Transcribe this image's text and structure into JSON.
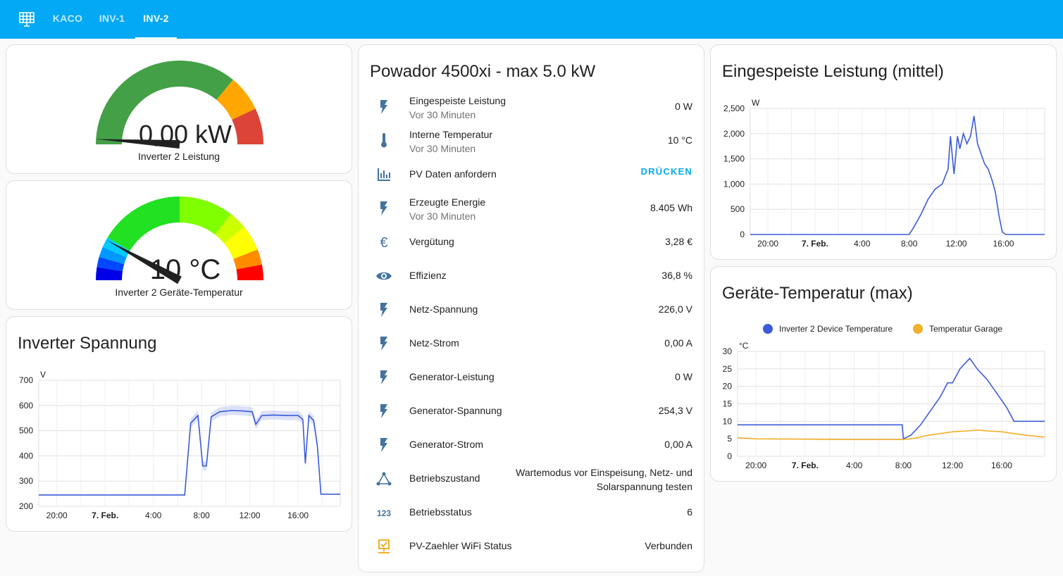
{
  "nav": {
    "tabs": [
      {
        "label": "KACO"
      },
      {
        "label": "INV-1"
      },
      {
        "label": "INV-2",
        "active": true
      }
    ],
    "accent": "#03a9f4",
    "icon": "solar-panel-grid-icon"
  },
  "gauge_power": {
    "value": "0,00 kW",
    "label": "Inverter 2 Leistung",
    "level": 0.0,
    "colors": {
      "green": "#43a047",
      "orange": "#ffa600",
      "red": "#db4437"
    }
  },
  "gauge_temp": {
    "value": "10 °C",
    "label": "Inverter 2 Geräte-Temperatur",
    "level": 0.16
  },
  "entities": {
    "title": "Powador 4500xi - max 5.0 kW",
    "rows": [
      {
        "icon": "flash-icon",
        "name": "Eingespeiste Leistung",
        "sub": "Vor 30 Minuten",
        "value": "0 W"
      },
      {
        "icon": "thermometer-icon",
        "name": "Interne Temperatur",
        "sub": "Vor 30 Minuten",
        "value": "10 °C"
      },
      {
        "icon": "bar-chart-icon",
        "name": "PV Daten anfordern",
        "button": "DRÜCKEN"
      },
      {
        "icon": "flash-icon",
        "name": "Erzeugte Energie",
        "sub": "Vor 30 Minuten",
        "value": "8.405 Wh"
      },
      {
        "icon": "euro-icon",
        "name": "Vergütung",
        "value": "3,28 €"
      },
      {
        "icon": "eye-icon",
        "name": "Effizienz",
        "value": "36,8 %"
      },
      {
        "icon": "flash-icon",
        "name": "Netz-Spannung",
        "value": "226,0 V"
      },
      {
        "icon": "flash-icon",
        "name": "Netz-Strom",
        "value": "0,00 A"
      },
      {
        "icon": "flash-icon",
        "name": "Generator-Leistung",
        "value": "0 W"
      },
      {
        "icon": "flash-icon",
        "name": "Generator-Spannung",
        "value": "254,3 V"
      },
      {
        "icon": "flash-icon",
        "name": "Generator-Strom",
        "value": "0,00 A"
      },
      {
        "icon": "network-icon",
        "name": "Betriebszustand",
        "value": "Wartemodus vor Einspeisung, Netz- und Solarspannung testen"
      },
      {
        "icon": "numeric-icon",
        "icon_text": "123",
        "name": "Betriebsstatus",
        "value": "6"
      },
      {
        "icon": "wifi-status-icon",
        "name": "PV-Zaehler WiFi Status",
        "value": "Verbunden"
      }
    ]
  },
  "chart_data": [
    {
      "type": "line",
      "title": "Inverter Spannung",
      "ylabel": "V",
      "xlabels": [
        "20:00",
        "7. Feb.",
        "4:00",
        "8:00",
        "12:00",
        "16:00"
      ],
      "x_hours": [
        20,
        24,
        28,
        32,
        36,
        40
      ],
      "yticks": [
        200,
        300,
        400,
        500,
        600,
        700
      ],
      "ylim": [
        200,
        700
      ],
      "xlim": [
        18.5,
        43.5
      ],
      "series": [
        {
          "color": "#3b5bdb",
          "points": [
            [
              18.5,
              245
            ],
            [
              30.6,
              245
            ],
            [
              31.1,
              530
            ],
            [
              31.7,
              560
            ],
            [
              32.1,
              360
            ],
            [
              32.4,
              360
            ],
            [
              32.8,
              555
            ],
            [
              33.5,
              575
            ],
            [
              34.5,
              580
            ],
            [
              35.5,
              578
            ],
            [
              36.2,
              575
            ],
            [
              36.5,
              525
            ],
            [
              37.0,
              560
            ],
            [
              38.0,
              562
            ],
            [
              39.0,
              560
            ],
            [
              40.0,
              560
            ],
            [
              40.4,
              545
            ],
            [
              40.6,
              370
            ],
            [
              40.9,
              560
            ],
            [
              41.3,
              540
            ],
            [
              41.6,
              440
            ],
            [
              41.9,
              248
            ],
            [
              43.5,
              248
            ]
          ]
        }
      ]
    },
    {
      "type": "line",
      "title": "Eingespeiste Leistung (mittel)",
      "ylabel": "W",
      "xlabels": [
        "20:00",
        "7. Feb.",
        "4:00",
        "8:00",
        "12:00",
        "16:00"
      ],
      "x_hours": [
        20,
        24,
        28,
        32,
        36,
        40
      ],
      "yticks": [
        0,
        500,
        1000,
        1500,
        2000,
        2500
      ],
      "ylim": [
        0,
        2500
      ],
      "xlim": [
        18.5,
        43.5
      ],
      "series": [
        {
          "color": "#3b5bdb",
          "points": [
            [
              18.5,
              0
            ],
            [
              32.0,
              0
            ],
            [
              32.4,
              150
            ],
            [
              33.0,
              400
            ],
            [
              33.6,
              700
            ],
            [
              34.2,
              900
            ],
            [
              34.8,
              1000
            ],
            [
              35.3,
              1300
            ],
            [
              35.5,
              1950
            ],
            [
              35.8,
              1200
            ],
            [
              36.1,
              1950
            ],
            [
              36.3,
              1700
            ],
            [
              36.6,
              2000
            ],
            [
              36.9,
              1800
            ],
            [
              37.2,
              1950
            ],
            [
              37.5,
              2350
            ],
            [
              37.8,
              1800
            ],
            [
              38.1,
              1600
            ],
            [
              38.4,
              1400
            ],
            [
              38.7,
              1300
            ],
            [
              39.0,
              1100
            ],
            [
              39.3,
              850
            ],
            [
              39.6,
              400
            ],
            [
              39.9,
              50
            ],
            [
              40.2,
              0
            ],
            [
              43.5,
              0
            ]
          ]
        }
      ]
    },
    {
      "type": "line",
      "title": "Geräte-Temperatur (max)",
      "ylabel": "°C",
      "xlabels": [
        "20:00",
        "7. Feb.",
        "4:00",
        "8:00",
        "12:00",
        "16:00"
      ],
      "x_hours": [
        20,
        24,
        28,
        32,
        36,
        40
      ],
      "yticks": [
        0,
        5,
        10,
        15,
        20,
        25,
        30
      ],
      "ylim": [
        0,
        30
      ],
      "xlim": [
        18.5,
        43.5
      ],
      "series": [
        {
          "name": "Inverter 2 Device Temperature",
          "color": "#3b5bdb",
          "points": [
            [
              18.5,
              9
            ],
            [
              31.9,
              9
            ],
            [
              32.0,
              5
            ],
            [
              32.6,
              6
            ],
            [
              33.4,
              9
            ],
            [
              34.2,
              13
            ],
            [
              35.0,
              17
            ],
            [
              35.6,
              21
            ],
            [
              36.0,
              21
            ],
            [
              36.6,
              25
            ],
            [
              37.4,
              28
            ],
            [
              38.0,
              25
            ],
            [
              38.8,
              22
            ],
            [
              39.6,
              18
            ],
            [
              40.4,
              14
            ],
            [
              41.0,
              10
            ],
            [
              43.5,
              10
            ]
          ]
        },
        {
          "name": "Temperatur Garage",
          "color": "#f1b02a",
          "points": [
            [
              18.5,
              5.3
            ],
            [
              20,
              5.0
            ],
            [
              24,
              4.9
            ],
            [
              28,
              4.8
            ],
            [
              32,
              4.8
            ],
            [
              33,
              5.2
            ],
            [
              34,
              6.0
            ],
            [
              35,
              6.5
            ],
            [
              36,
              7.0
            ],
            [
              37,
              7.2
            ],
            [
              38,
              7.5
            ],
            [
              39,
              7.2
            ],
            [
              40,
              7.0
            ],
            [
              41,
              6.5
            ],
            [
              42,
              6.0
            ],
            [
              43.5,
              5.5
            ]
          ]
        }
      ]
    }
  ]
}
